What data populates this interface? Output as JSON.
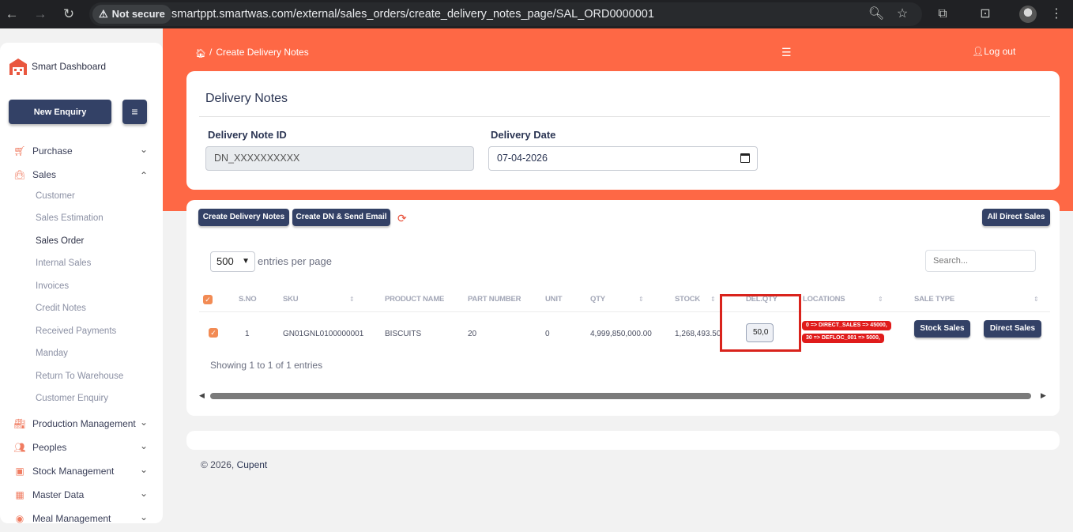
{
  "browser": {
    "security_label": "Not secure",
    "url": "smartppt.smartwas.com/external/sales_orders/create_delivery_notes_page/SAL_ORD0000001"
  },
  "sidebar": {
    "brand": "Smart Dashboard",
    "new_enquiry": "New Enquiry",
    "menu": [
      {
        "label": "Purchase",
        "icon": "cart-icon"
      },
      {
        "label": "Sales",
        "icon": "bag-icon"
      },
      {
        "label": "Production Management",
        "icon": "factory-icon"
      },
      {
        "label": "Peoples",
        "icon": "people-icon"
      },
      {
        "label": "Stock Management",
        "icon": "box-icon"
      },
      {
        "label": "Master Data",
        "icon": "grid-icon"
      },
      {
        "label": "Meal Management",
        "icon": "meal-icon"
      }
    ],
    "sales_sub": [
      "Customer",
      "Sales Estimation",
      "Sales Order",
      "Internal Sales",
      "Invoices",
      "Credit Notes",
      "Received Payments",
      "Manday",
      "Return To Warehouse",
      "Customer Enquiry"
    ]
  },
  "header": {
    "breadcrumb_sep": "/",
    "breadcrumb": "Create Delivery Notes",
    "logout": "Log out"
  },
  "form": {
    "title": "Delivery Notes",
    "dn_id_label": "Delivery Note ID",
    "dn_id_value": "DN_XXXXXXXXXX",
    "date_label": "Delivery Date",
    "date_value": "07-04-2026"
  },
  "toolbar": {
    "create_dn": "Create Delivery Notes",
    "create_dn_email": "Create DN & Send Email",
    "all_direct_sales": "All Direct Sales",
    "page_size": "500",
    "entries_per_page": "entries per page",
    "search_placeholder": "Search..."
  },
  "table": {
    "columns": [
      "S.NO",
      "SKU",
      "PRODUCT NAME",
      "PART NUMBER",
      "UNIT",
      "QTY",
      "STOCK",
      "DEL.QTY",
      "LOCATIONS",
      "SALE TYPE"
    ],
    "rows": [
      {
        "sno": "1",
        "sku": "GN01GNL0100000001",
        "product": "BISCUITS",
        "part": "20",
        "unit": "0",
        "qty": "4,999,850,000.00",
        "stock": "1,268,493.50",
        "del_qty": "50,0",
        "locations": [
          "0 => DIRECT_SALES => 45000,",
          "30 => DEFLOC_001 => 5000,"
        ],
        "stock_sales": "Stock Sales",
        "direct_sales": "Direct Sales"
      }
    ],
    "info": "Showing 1 to 1 of 1 entries"
  },
  "footer": {
    "copyright": "© 2026,",
    "company": "Cupent"
  },
  "colors": {
    "accent": "#fe6845",
    "button": "#334166",
    "highlight": "#d9231c"
  }
}
